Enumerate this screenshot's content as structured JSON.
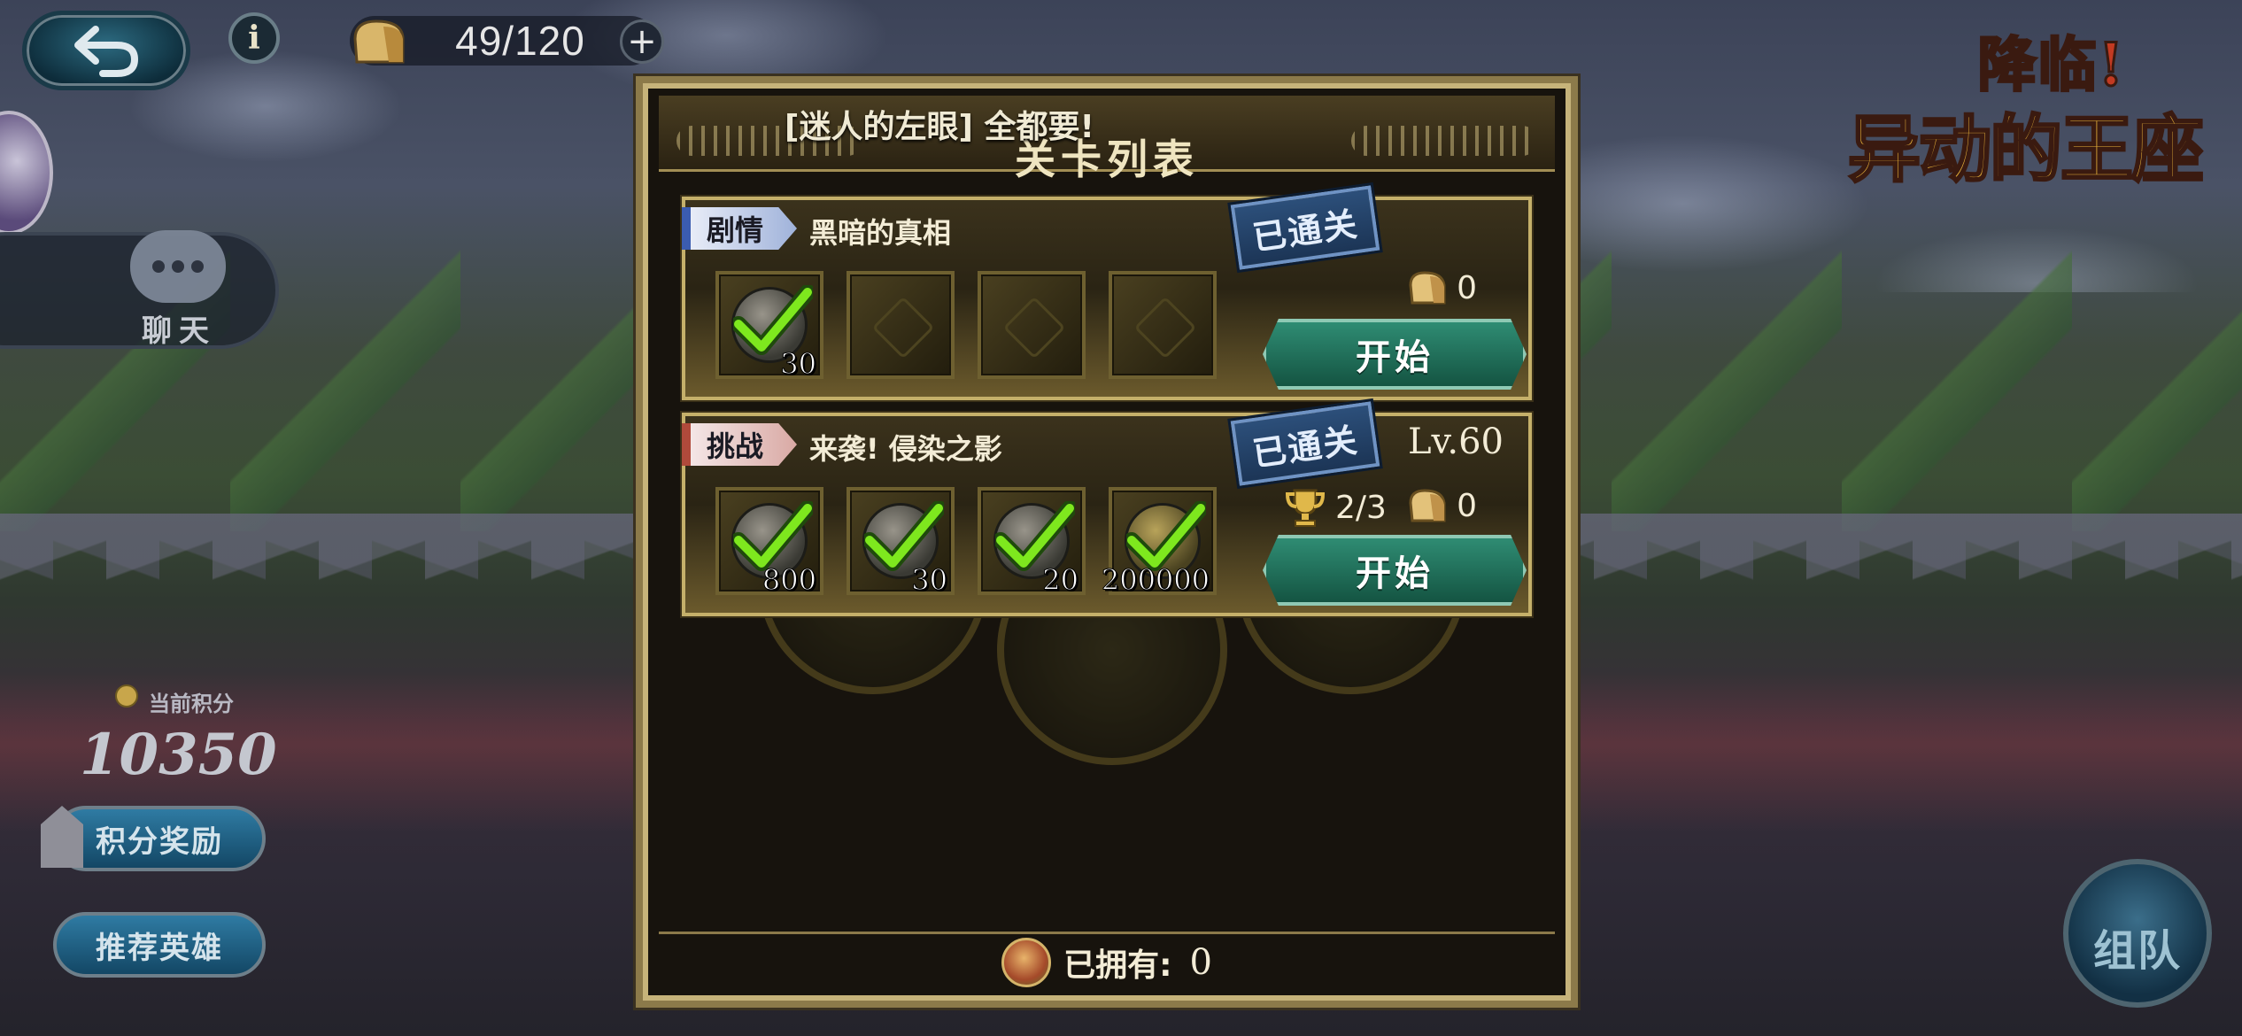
{
  "hud": {
    "stamina": "49/120",
    "info_symbol": "i",
    "stamina_plus": "+"
  },
  "chat": {
    "label": "聊天"
  },
  "score": {
    "label": "当前积分",
    "value": "10350"
  },
  "side_buttons": {
    "reward": "积分奖励",
    "recommend": "推荐英雄"
  },
  "logo": {
    "line1": "降临!",
    "line2": "异动的王座"
  },
  "team_button": "组队",
  "dialog": {
    "event_title": "[迷人的左眼] 全都要!",
    "title": "关卡列表",
    "stages": [
      {
        "tag": "剧情",
        "name": "黑暗的真相",
        "status": "已通关",
        "cost": "0",
        "start_label": "开始",
        "rewards": [
          {
            "qty": "30",
            "cleared": true
          },
          {
            "qty": "",
            "cleared": false
          },
          {
            "qty": "",
            "cleared": false
          },
          {
            "qty": "",
            "cleared": false
          }
        ]
      },
      {
        "tag": "挑战",
        "name": "来袭!  侵染之影",
        "status": "已通关",
        "level": "Lv.60",
        "trophy": "2/3",
        "cost": "0",
        "start_label": "开始",
        "rewards": [
          {
            "qty": "800",
            "cleared": true
          },
          {
            "qty": "30",
            "cleared": true
          },
          {
            "qty": "20",
            "cleared": true
          },
          {
            "qty": "200000",
            "cleared": true
          }
        ]
      }
    ],
    "owned_label": "已拥有:",
    "owned_value": "0"
  },
  "colors": {
    "gold_border": "#c5b06a",
    "start_button": "#2f8c73",
    "cleared_stamp": "#2c4f7a",
    "check_green": "#7ee81e"
  },
  "icons": {
    "back": "back-arrow-icon",
    "info": "info-icon",
    "stamina": "bread-icon",
    "chat": "chat-bubble-icon",
    "check": "checkmark-icon",
    "trophy": "trophy-icon",
    "owned": "token-icon"
  }
}
